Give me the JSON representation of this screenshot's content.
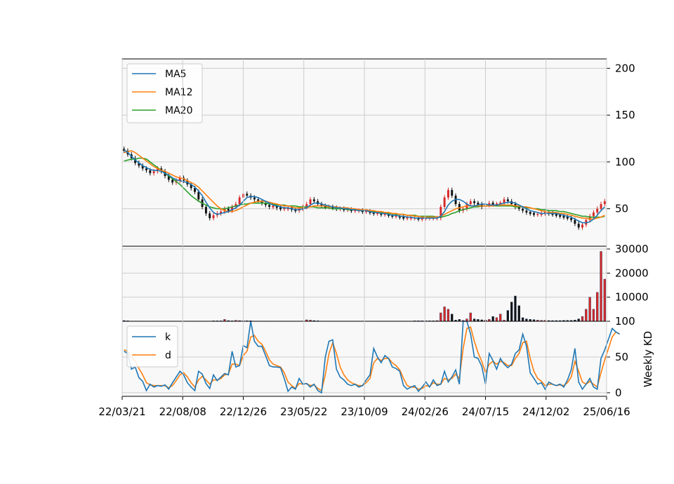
{
  "chart_data": [
    {
      "type": "candlestick",
      "panel": "price",
      "yticks": [
        50,
        100,
        150,
        200
      ],
      "ylim": [
        10,
        210
      ],
      "grid": true,
      "legend_position": "upper-left",
      "legend": [
        "MA5",
        "MA12",
        "MA20"
      ],
      "colors": {
        "up": "#d62728",
        "down": "#111111",
        "MA5": "#1f77b4",
        "MA12": "#ff7f0e",
        "MA20": "#2ca02c"
      },
      "price_close": [
        112,
        108,
        104,
        99,
        96,
        93,
        91,
        88,
        90,
        93,
        90,
        85,
        81,
        78,
        80,
        83,
        80,
        76,
        72,
        68,
        60,
        52,
        45,
        40,
        43,
        45,
        47,
        50,
        48,
        52,
        55,
        62,
        66,
        64,
        62,
        60,
        58,
        56,
        54,
        52,
        53,
        51,
        50,
        50,
        51,
        49,
        48,
        50,
        52,
        55,
        60,
        58,
        55,
        53,
        52,
        52,
        51,
        50,
        50,
        49,
        49,
        48,
        48,
        48,
        47,
        47,
        46,
        45,
        45,
        44,
        44,
        43,
        42,
        42,
        41,
        40,
        40,
        40,
        40,
        39,
        40,
        40,
        40,
        40,
        40,
        52,
        62,
        70,
        64,
        55,
        48,
        50,
        55,
        58,
        56,
        55,
        52,
        54,
        56,
        55,
        55,
        56,
        60,
        58,
        55,
        52,
        50,
        48,
        46,
        45,
        44,
        44,
        45,
        46,
        45,
        44,
        43,
        42,
        41,
        40,
        38,
        34,
        30,
        33,
        38,
        42,
        46,
        50,
        55,
        58
      ],
      "ma5": [
        113,
        110,
        106,
        102,
        99,
        96,
        94,
        92,
        91,
        91,
        90,
        88,
        86,
        83,
        81,
        80,
        79,
        78,
        76,
        73,
        69,
        64,
        57,
        51,
        46,
        44,
        45,
        46,
        47,
        49,
        51,
        54,
        58,
        62,
        63,
        63,
        62,
        60,
        58,
        56,
        54,
        53,
        52,
        51,
        51,
        50,
        49,
        49,
        50,
        51,
        54,
        56,
        56,
        55,
        54,
        53,
        52,
        51,
        51,
        50,
        50,
        49,
        49,
        48,
        48,
        48,
        47,
        46,
        46,
        45,
        45,
        44,
        43,
        43,
        42,
        42,
        41,
        41,
        40,
        40,
        40,
        40,
        40,
        40,
        40,
        42,
        47,
        54,
        58,
        60,
        60,
        58,
        55,
        53,
        53,
        54,
        55,
        55,
        54,
        54,
        54,
        55,
        56,
        57,
        57,
        56,
        54,
        52,
        50,
        48,
        47,
        46,
        45,
        45,
        45,
        45,
        45,
        44,
        43,
        42,
        41,
        39,
        37,
        35,
        35,
        36,
        39,
        43,
        48,
        52
      ],
      "ma12": [
        110,
        111,
        112,
        110,
        107,
        104,
        101,
        98,
        95,
        93,
        91,
        90,
        88,
        86,
        84,
        83,
        82,
        80,
        78,
        76,
        73,
        69,
        65,
        61,
        57,
        53,
        50,
        48,
        47,
        47,
        48,
        50,
        52,
        54,
        56,
        57,
        58,
        58,
        58,
        57,
        56,
        55,
        54,
        53,
        53,
        52,
        51,
        51,
        51,
        51,
        52,
        53,
        53,
        53,
        53,
        52,
        52,
        52,
        51,
        51,
        51,
        50,
        50,
        49,
        49,
        49,
        48,
        48,
        47,
        47,
        46,
        46,
        45,
        45,
        44,
        44,
        43,
        43,
        42,
        42,
        41,
        41,
        41,
        41,
        41,
        42,
        44,
        46,
        48,
        50,
        51,
        52,
        53,
        53,
        53,
        53,
        53,
        53,
        53,
        53,
        54,
        54,
        54,
        54,
        54,
        53,
        53,
        52,
        52,
        51,
        50,
        49,
        48,
        47,
        46,
        46,
        46,
        45,
        45,
        44,
        43,
        42,
        41,
        40,
        40,
        39,
        39,
        40,
        41,
        43
      ],
      "ma20": [
        101,
        102,
        103,
        103,
        104,
        104,
        103,
        100,
        97,
        94,
        91,
        88,
        85,
        82,
        79,
        76,
        72,
        68,
        64,
        61,
        58,
        56,
        54,
        52,
        51,
        50,
        50,
        50,
        51,
        52,
        53,
        54,
        55,
        55,
        56,
        56,
        56,
        56,
        56,
        55,
        55,
        54,
        54,
        54,
        53,
        53,
        53,
        52,
        52,
        52,
        52,
        52,
        51,
        51,
        51,
        51,
        50,
        50,
        50,
        50,
        49,
        49,
        49,
        48,
        48,
        48,
        47,
        47,
        46,
        46,
        46,
        45,
        45,
        44,
        44,
        44,
        43,
        43,
        43,
        42,
        42,
        42,
        42,
        42,
        41,
        41,
        42,
        43,
        45,
        46,
        48,
        49,
        50,
        51,
        52,
        52,
        53,
        53,
        53,
        53,
        53,
        53,
        53,
        53,
        53,
        52,
        52,
        52,
        51,
        51,
        50,
        50,
        49,
        49,
        48,
        48,
        48,
        47,
        47,
        46,
        45,
        44,
        43,
        42,
        42,
        41,
        41,
        41,
        41,
        42
      ]
    },
    {
      "type": "bar",
      "panel": "volume",
      "yticks": [
        10000,
        20000,
        30000
      ],
      "ylim": [
        0,
        30000
      ],
      "grid": true,
      "values": [
        300,
        200,
        100,
        100,
        100,
        100,
        100,
        100,
        100,
        100,
        100,
        100,
        100,
        100,
        100,
        100,
        100,
        100,
        100,
        100,
        100,
        100,
        100,
        100,
        200,
        200,
        200,
        800,
        300,
        200,
        400,
        300,
        200,
        200,
        200,
        100,
        100,
        100,
        100,
        100,
        100,
        100,
        100,
        100,
        100,
        100,
        100,
        100,
        100,
        600,
        500,
        300,
        200,
        100,
        100,
        100,
        100,
        100,
        100,
        100,
        100,
        100,
        100,
        100,
        100,
        100,
        100,
        100,
        100,
        100,
        100,
        100,
        100,
        100,
        100,
        100,
        100,
        100,
        200,
        200,
        200,
        200,
        200,
        200,
        300,
        3500,
        6000,
        5000,
        3000,
        500,
        800,
        400,
        1000,
        3500,
        1000,
        800,
        600,
        500,
        800,
        2000,
        1500,
        3000,
        500,
        4500,
        8000,
        10500,
        6500,
        1500,
        1000,
        800,
        700,
        500,
        400,
        400,
        300,
        300,
        300,
        300,
        400,
        400,
        400,
        500,
        1000,
        2000,
        5000,
        10000,
        5000,
        12000,
        29000,
        17500
      ],
      "colors": {
        "up": "#d62728",
        "down": "#111111"
      }
    },
    {
      "type": "line",
      "panel": "kd",
      "ylabel": "Weekly KD",
      "yticks": [
        0,
        50,
        100
      ],
      "ylim": [
        -5,
        100
      ],
      "grid": true,
      "legend_position": "upper-left",
      "series": [
        {
          "name": "k",
          "color": "#1f77b4",
          "values": [
            58,
            55,
            33,
            36,
            21,
            16,
            3,
            12,
            8,
            10,
            9,
            11,
            5,
            14,
            22,
            30,
            25,
            14,
            8,
            3,
            30,
            26,
            13,
            6,
            25,
            17,
            22,
            27,
            25,
            58,
            36,
            38,
            66,
            63,
            100,
            72,
            65,
            65,
            52,
            38,
            36,
            36,
            35,
            20,
            2,
            8,
            5,
            20,
            12,
            13,
            8,
            12,
            3,
            0,
            50,
            72,
            74,
            33,
            22,
            18,
            12,
            10,
            12,
            8,
            10,
            18,
            25,
            62,
            50,
            42,
            52,
            48,
            36,
            34,
            30,
            10,
            5,
            8,
            10,
            2,
            8,
            15,
            8,
            18,
            10,
            12,
            30,
            15,
            22,
            32,
            12,
            100,
            100,
            82,
            50,
            48,
            37,
            12,
            55,
            45,
            33,
            48,
            40,
            35,
            40,
            55,
            60,
            82,
            65,
            28,
            20,
            12,
            14,
            5,
            15,
            12,
            10,
            12,
            8,
            18,
            32,
            62,
            15,
            5,
            12,
            20,
            8,
            5,
            48,
            60,
            75,
            90,
            85,
            82
          ]
        },
        {
          "name": "d",
          "color": "#ff7f0e",
          "values": [
            60,
            58,
            50,
            44,
            34,
            25,
            14,
            11,
            10,
            10,
            10,
            10,
            7,
            10,
            17,
            25,
            28,
            22,
            14,
            8,
            18,
            23,
            18,
            12,
            18,
            18,
            20,
            25,
            26,
            40,
            40,
            38,
            52,
            58,
            78,
            80,
            72,
            68,
            58,
            46,
            40,
            38,
            36,
            28,
            15,
            10,
            6,
            13,
            12,
            13,
            10,
            11,
            6,
            3,
            25,
            55,
            70,
            55,
            36,
            25,
            18,
            14,
            12,
            10,
            10,
            14,
            20,
            42,
            48,
            45,
            48,
            48,
            42,
            38,
            32,
            20,
            10,
            8,
            8,
            5,
            6,
            10,
            9,
            14,
            12,
            12,
            20,
            18,
            20,
            26,
            20,
            62,
            90,
            92,
            72,
            56,
            44,
            28,
            40,
            44,
            40,
            44,
            42,
            38,
            38,
            48,
            55,
            70,
            72,
            48,
            30,
            20,
            16,
            10,
            12,
            12,
            10,
            11,
            10,
            14,
            22,
            44,
            30,
            15,
            12,
            16,
            12,
            8,
            28,
            46,
            62,
            78,
            85,
            82
          ]
        }
      ]
    }
  ],
  "xaxis": {
    "ticks": [
      "22/03/21",
      "22/08/08",
      "22/12/26",
      "23/05/22",
      "23/10/09",
      "24/02/26",
      "24/07/15",
      "24/12/02",
      "25/06/16"
    ]
  }
}
